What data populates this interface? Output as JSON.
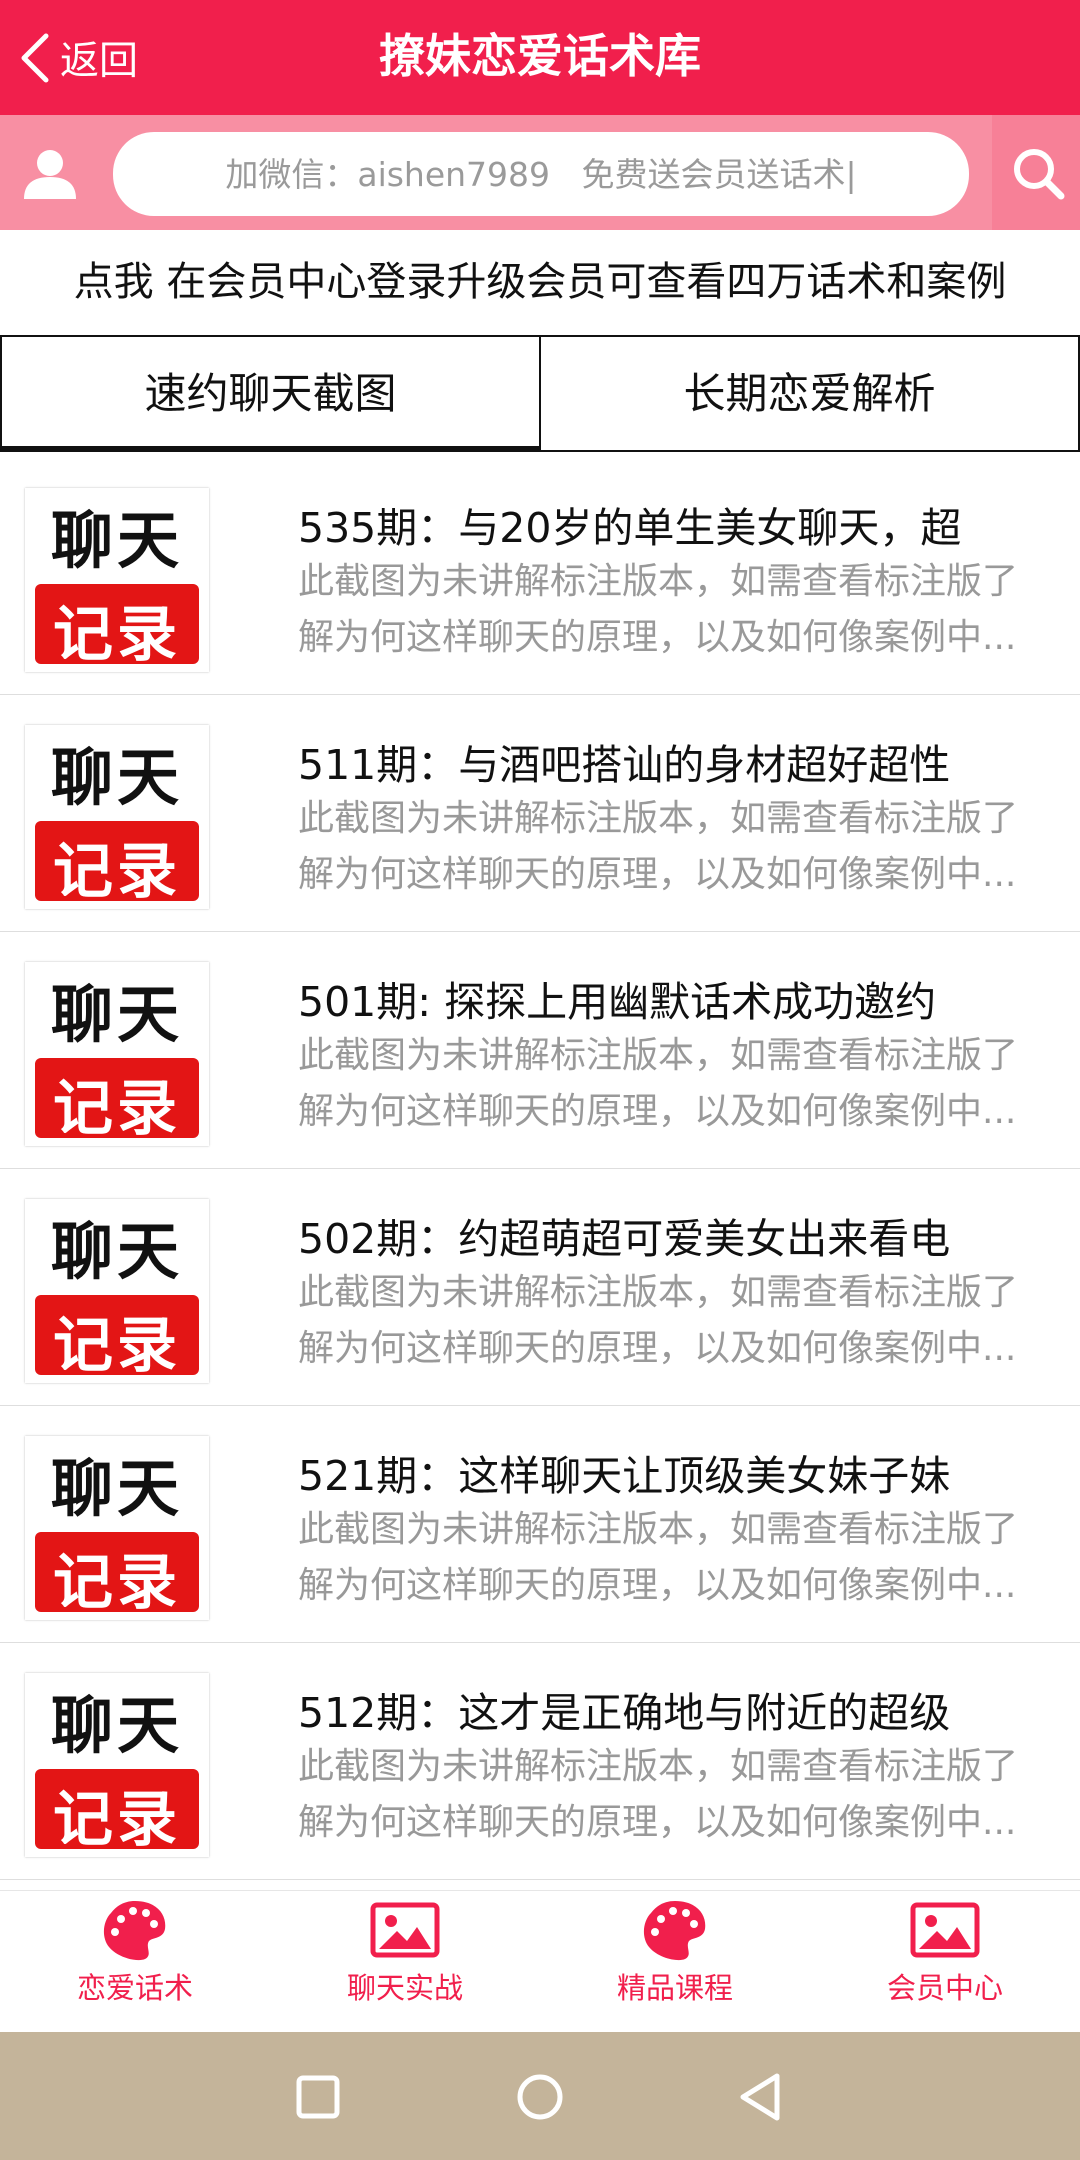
{
  "header": {
    "back_label": "返回",
    "title": "撩妹恋爱话术库"
  },
  "search": {
    "placeholder": "加微信：aishen7989   免费送会员送话术|"
  },
  "promo": "点我 在会员中心登录升级会员可查看四万话术和案例",
  "tabs": [
    {
      "label": "速约聊天截图",
      "active": true
    },
    {
      "label": "长期恋爱解析",
      "active": false
    }
  ],
  "thumb": {
    "line1": "聊天",
    "line2": "记录"
  },
  "items": [
    {
      "title": "535期：与20岁的单生美女聊天，超",
      "desc": "此截图为未讲解标注版本，如需查看标注版了解为何这样聊天的原理，以及如何像案例中..."
    },
    {
      "title": "511期：与酒吧搭讪的身材超好超性",
      "desc": "此截图为未讲解标注版本，如需查看标注版了解为何这样聊天的原理，以及如何像案例中..."
    },
    {
      "title": "501期: 探探上用幽默话术成功邀约",
      "desc": "此截图为未讲解标注版本，如需查看标注版了解为何这样聊天的原理，以及如何像案例中..."
    },
    {
      "title": "502期：约超萌超可爱美女出来看电",
      "desc": "此截图为未讲解标注版本，如需查看标注版了解为何这样聊天的原理，以及如何像案例中..."
    },
    {
      "title": "521期：这样聊天让顶级美女妹子妹",
      "desc": "此截图为未讲解标注版本，如需查看标注版了解为何这样聊天的原理，以及如何像案例中..."
    },
    {
      "title": "512期：这才是正确地与附近的超级",
      "desc": "此截图为未讲解标注版本，如需查看标注版了解为何这样聊天的原理，以及如何像案例中..."
    }
  ],
  "bottom_nav": [
    {
      "label": "恋爱话术",
      "icon": "palette-icon"
    },
    {
      "label": "聊天实战",
      "icon": "image-icon"
    },
    {
      "label": "精品课程",
      "icon": "palette-icon"
    },
    {
      "label": "会员中心",
      "icon": "image-icon"
    }
  ],
  "colors": {
    "accent": "#f11f4c",
    "search_bar": "#f88fa3",
    "system_nav": "#c4b49a"
  }
}
